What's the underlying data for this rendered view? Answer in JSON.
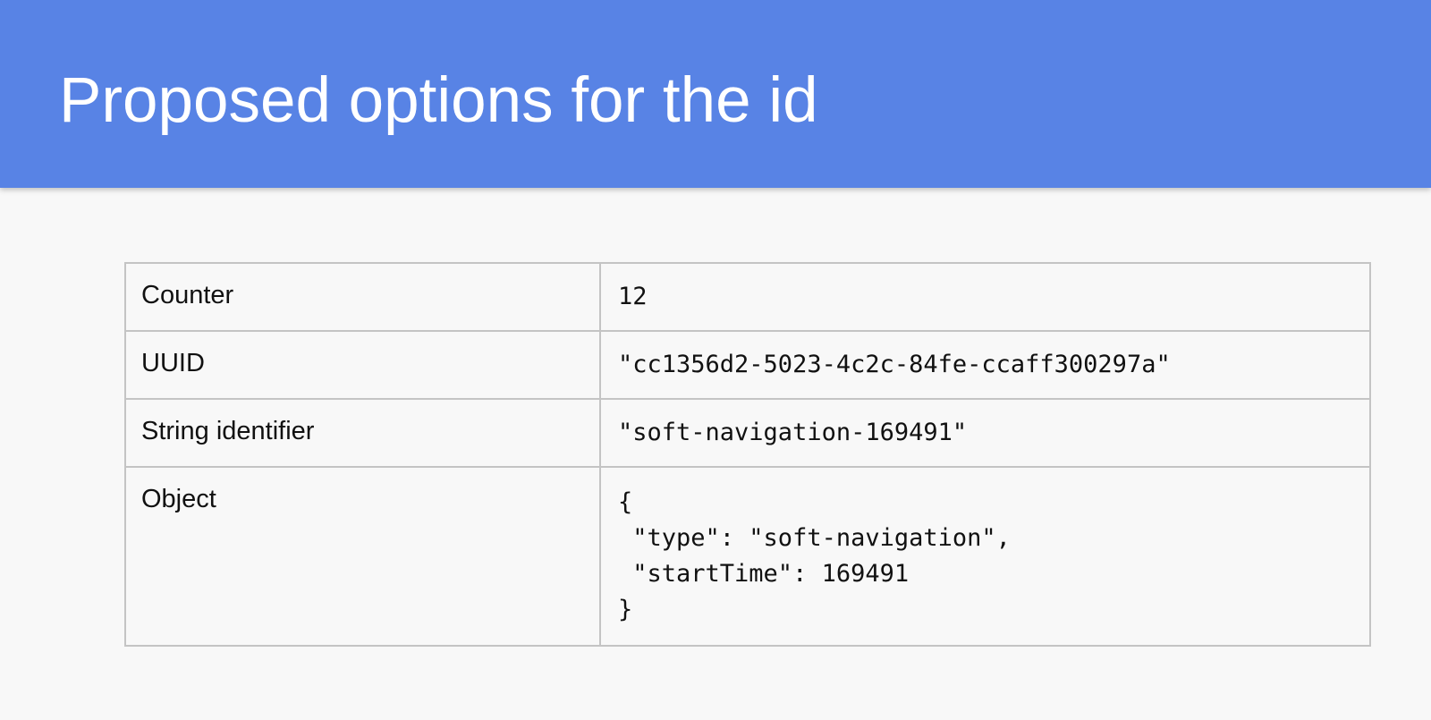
{
  "title": "Proposed options for the id",
  "colors": {
    "header_bg": "#5883e5",
    "title_text": "#ffffff",
    "body_bg": "#f8f8f8",
    "table_border": "#c4c4c4"
  },
  "rows": [
    {
      "label": "Counter",
      "value": "12"
    },
    {
      "label": "UUID",
      "value": "\"cc1356d2-5023-4c2c-84fe-ccaff300297a\""
    },
    {
      "label": "String identifier",
      "value": "\"soft-navigation-169491\""
    },
    {
      "label": "Object",
      "value_lines": [
        "{",
        " \"type\": \"soft-navigation\",",
        " \"startTime\": 169491",
        "}"
      ]
    }
  ]
}
